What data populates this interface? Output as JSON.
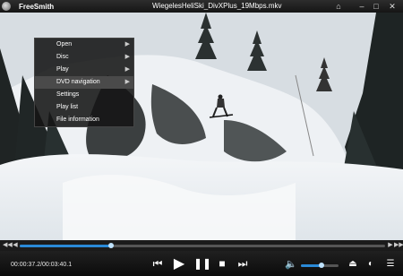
{
  "app": {
    "name": "FreeSmith",
    "file_title": "WiegelesHeliSki_DivXPlus_19Mbps.mkv"
  },
  "window_controls": {
    "home": "⌂",
    "minimize": "–",
    "maximize": "□",
    "close": "✕"
  },
  "menu": {
    "items": [
      {
        "label": "Open",
        "has_submenu": true
      },
      {
        "label": "Disc",
        "has_submenu": true
      },
      {
        "label": "Play",
        "has_submenu": true
      },
      {
        "label": "DVD navigation",
        "has_submenu": true,
        "active": true
      },
      {
        "label": "Settings",
        "has_submenu": false
      },
      {
        "label": "Play list",
        "has_submenu": false
      },
      {
        "label": "File information",
        "has_submenu": false
      }
    ]
  },
  "playback": {
    "time_display": "00:00:37.2/00:03:40.1",
    "progress": 0.25,
    "volume": 0.55
  },
  "colors": {
    "accent": "#2a8ad8",
    "menu_bg": "#141414",
    "menu_active": "#4a4a4a"
  }
}
